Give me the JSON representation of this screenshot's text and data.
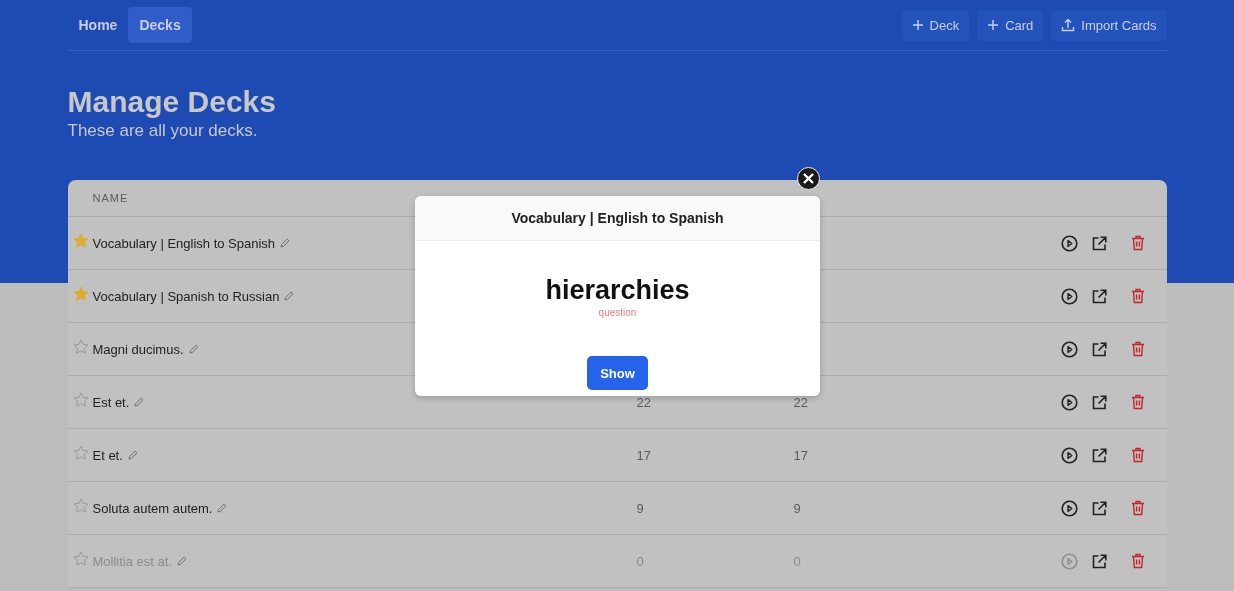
{
  "nav": {
    "links": [
      {
        "label": "Home",
        "selected": false
      },
      {
        "label": "Decks",
        "selected": true
      }
    ],
    "actions": [
      {
        "label": "Deck",
        "kind": "create"
      },
      {
        "label": "Card",
        "kind": "create"
      },
      {
        "label": "Import Cards",
        "kind": "import"
      }
    ]
  },
  "header": {
    "title": "Manage Decks",
    "subtitle": "These are all your decks."
  },
  "table": {
    "columns": [
      {
        "label": "NAME"
      }
    ],
    "rows": [
      {
        "name": "Vocabulary | English to Spanish",
        "favorite": true,
        "disabled": false
      },
      {
        "name": "Vocabulary | Spanish to Russian",
        "favorite": true,
        "disabled": false
      },
      {
        "name": "Magni ducimus.",
        "favorite": false,
        "disabled": false
      },
      {
        "name": "Est et.",
        "favorite": false,
        "disabled": false,
        "cards": "22",
        "due": "22"
      },
      {
        "name": "Et et.",
        "favorite": false,
        "disabled": false,
        "cards": "17",
        "due": "17"
      },
      {
        "name": "Soluta autem autem.",
        "favorite": false,
        "disabled": false,
        "cards": "9",
        "due": "9"
      },
      {
        "name": "Mollitia est at.",
        "favorite": false,
        "disabled": true,
        "cards": "0",
        "due": "0"
      }
    ]
  },
  "modal": {
    "title": "Vocabulary | English to Spanish",
    "word": "hierarchies",
    "side": "question",
    "button": "Show"
  }
}
